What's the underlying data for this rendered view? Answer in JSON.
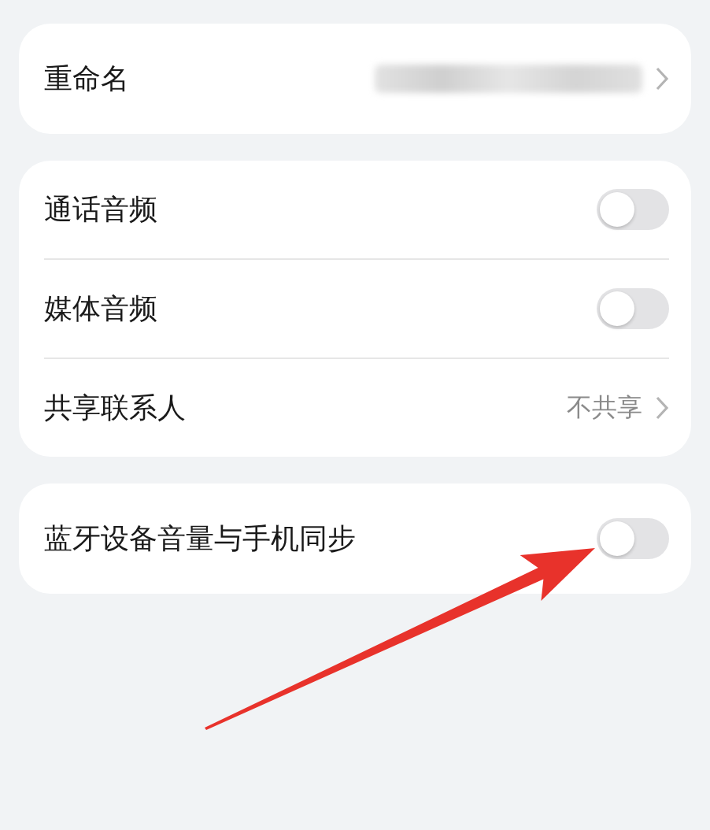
{
  "groups": [
    {
      "rows": [
        {
          "kind": "link",
          "label": "重命名",
          "blurred_value": true
        }
      ]
    },
    {
      "rows": [
        {
          "kind": "toggle",
          "label": "通话音频",
          "on": false
        },
        {
          "kind": "toggle",
          "label": "媒体音频",
          "on": false
        },
        {
          "kind": "link",
          "label": "共享联系人",
          "value": "不共享"
        }
      ]
    },
    {
      "rows": [
        {
          "kind": "toggle",
          "label": "蓝牙设备音量与手机同步",
          "on": false
        }
      ]
    }
  ]
}
